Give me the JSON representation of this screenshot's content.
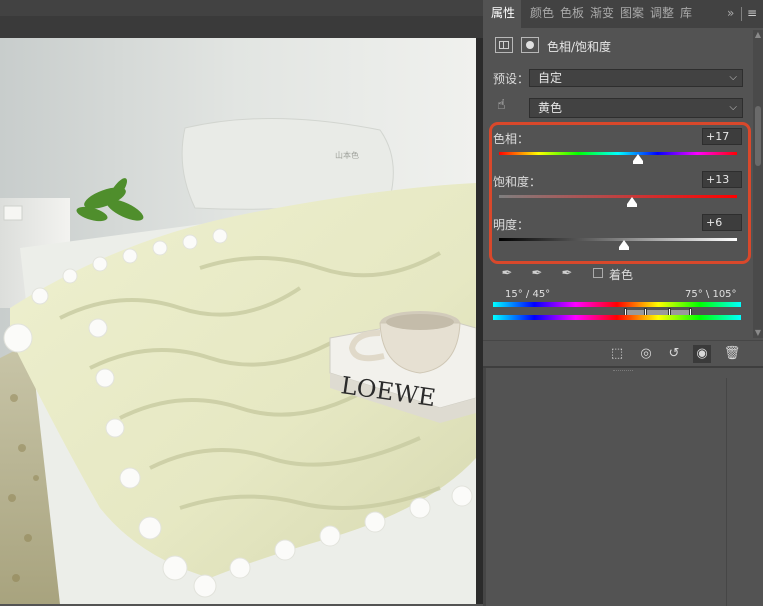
{
  "panel_tabs": [
    {
      "label": "属性",
      "active": true
    },
    {
      "label": "颜色",
      "active": false
    },
    {
      "label": "色板",
      "active": false
    },
    {
      "label": "渐变",
      "active": false
    },
    {
      "label": "图案",
      "active": false
    },
    {
      "label": "调整",
      "active": false
    },
    {
      "label": "库",
      "active": false
    }
  ],
  "tab_more": "»",
  "tab_menu": "≡",
  "adjustment_title": "色相/饱和度",
  "preset": {
    "label": "预设：",
    "value": "自定"
  },
  "channel": {
    "value": "黄色"
  },
  "sliders": {
    "hue": {
      "label": "色相：",
      "value": "+17",
      "position": 0.573
    },
    "saturation": {
      "label": "饱和度：",
      "value": "+13",
      "position": 0.561
    },
    "lightness": {
      "label": "明度：",
      "value": "+6",
      "position": 0.53
    }
  },
  "colorize": {
    "label": "着色",
    "checked": false
  },
  "range": {
    "left": "15° / 45°",
    "right": "75° \\ 105°"
  },
  "colors": {
    "highlight": "#d9482b",
    "panel_bg": "#535353",
    "tab_bg": "#424242"
  },
  "photo": {
    "book_text": "LOEWE",
    "pillow_text": "山本色"
  }
}
